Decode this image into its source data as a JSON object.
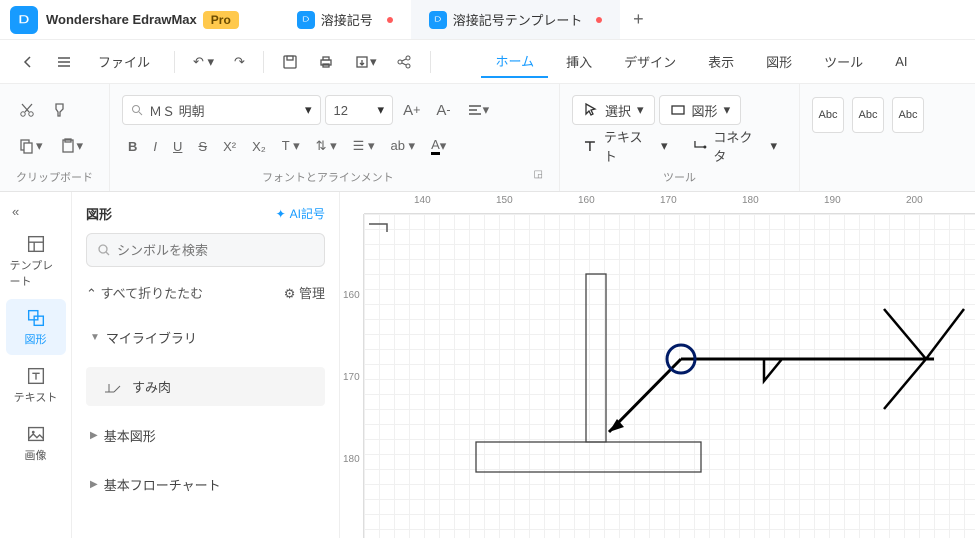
{
  "app": {
    "name": "Wondershare EdrawMax",
    "pro": "Pro"
  },
  "tabs": [
    {
      "label": "溶接記号",
      "active": false,
      "dirty": true
    },
    {
      "label": "溶接記号テンプレート",
      "active": true,
      "dirty": true
    }
  ],
  "menubar": {
    "file": "ファイル",
    "items": [
      "ホーム",
      "挿入",
      "デザイン",
      "表示",
      "図形",
      "ツール",
      "AI"
    ],
    "active_index": 0,
    "hot": "hot"
  },
  "toolbar": {
    "clipboard_label": "クリップボード",
    "font_name": "ＭＳ 明朝",
    "font_size": "12",
    "font_group_label": "フォントとアラインメント",
    "select": "選択",
    "shape": "図形",
    "text": "テキスト",
    "connector": "コネクタ",
    "tools_label": "ツール",
    "abc": "Abc"
  },
  "sidebar": {
    "template": "テンプレート",
    "shapes": "図形",
    "text": "テキスト",
    "image": "画像"
  },
  "panel": {
    "title": "図形",
    "ai": "AI記号",
    "search_placeholder": "シンボルを検索",
    "collapse_all": "すべて折りたたむ",
    "manage": "管理",
    "my_library": "マイライブラリ",
    "sumi": "すみ肉",
    "basic_shapes": "基本図形",
    "basic_flowchart": "基本フローチャート"
  },
  "ruler": {
    "h": [
      "140",
      "150",
      "160",
      "170",
      "180",
      "190",
      "200"
    ],
    "v": [
      "160",
      "170",
      "180"
    ]
  }
}
